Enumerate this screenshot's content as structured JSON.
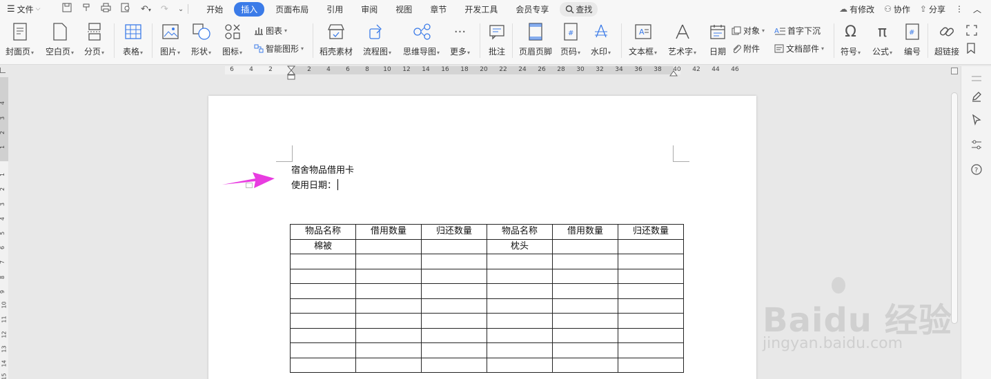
{
  "menu": {
    "file_label": "文件",
    "tabs": [
      "开始",
      "插入",
      "页面布局",
      "引用",
      "审阅",
      "视图",
      "章节",
      "开发工具",
      "会员专享"
    ],
    "active_tab": "插入",
    "search_label": "查找",
    "right": {
      "modified": "有修改",
      "collab": "协作",
      "share": "分享"
    }
  },
  "ribbon": {
    "cover": "封面页",
    "blank": "空白页",
    "page_break": "分页",
    "table": "表格",
    "picture": "图片",
    "shape": "形状",
    "icon": "图标",
    "chart": "图表",
    "smart": "智能图形",
    "material": "稻壳素材",
    "flowchart": "流程图",
    "mindmap": "思维导图",
    "more": "更多",
    "comment": "批注",
    "header_footer": "页眉页脚",
    "page_number": "页码",
    "watermark": "水印",
    "textbox": "文本框",
    "wordart": "艺术字",
    "date": "日期",
    "object": "对象",
    "attachment": "附件",
    "dropcap": "首字下沉",
    "doc_parts": "文档部件",
    "symbol": "符号",
    "formula": "公式",
    "numbering": "编号",
    "hyperlink": "超链接"
  },
  "ruler": {
    "h_ticks": [
      "6",
      "4",
      "2",
      "2",
      "4",
      "6",
      "8",
      "10",
      "12",
      "14",
      "16",
      "18",
      "20",
      "22",
      "24",
      "26",
      "28",
      "30",
      "32",
      "34",
      "36",
      "38",
      "40",
      "42",
      "44",
      "46"
    ],
    "v_ticks": [
      "4",
      "3",
      "2",
      "1",
      "1",
      "2",
      "3",
      "4",
      "5",
      "6",
      "7",
      "8",
      "9",
      "10",
      "11",
      "12",
      "13",
      "14",
      "15"
    ]
  },
  "document": {
    "title": "宿舍物品借用卡",
    "date_label": "使用日期：",
    "table": {
      "headers": [
        "物品名称",
        "借用数量",
        "归还数量",
        "物品名称",
        "借用数量",
        "归还数量"
      ],
      "rows": [
        [
          "棉被",
          "",
          "",
          "枕头",
          "",
          ""
        ],
        [
          "",
          "",
          "",
          "",
          "",
          ""
        ],
        [
          "",
          "",
          "",
          "",
          "",
          ""
        ],
        [
          "",
          "",
          "",
          "",
          "",
          ""
        ],
        [
          "",
          "",
          "",
          "",
          "",
          ""
        ],
        [
          "",
          "",
          "",
          "",
          "",
          ""
        ],
        [
          "",
          "",
          "",
          "",
          "",
          ""
        ],
        [
          "",
          "",
          "",
          "",
          "",
          ""
        ],
        [
          "",
          "",
          "",
          "",
          "",
          ""
        ]
      ]
    }
  },
  "watermark": {
    "brand": "Bai",
    "brand2": "经验",
    "url": "jingyan.baidu.com"
  },
  "colors": {
    "accent": "#3b7be8",
    "arrow": "#e83ce0"
  }
}
